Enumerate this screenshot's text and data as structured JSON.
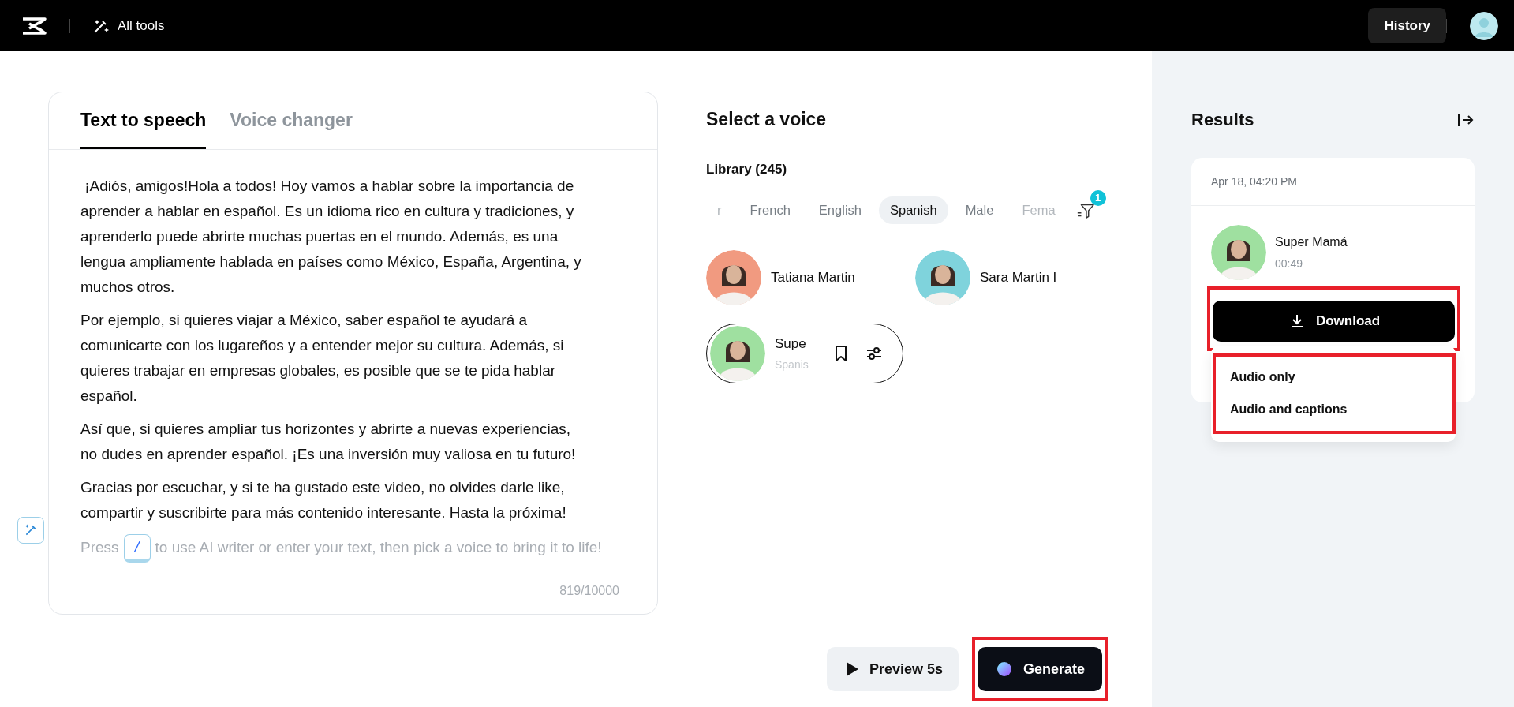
{
  "top_bar": {
    "all_tools": "All tools",
    "history": "History"
  },
  "editor": {
    "tabs": [
      {
        "label": "Text to speech",
        "selected": true
      },
      {
        "label": "Voice changer",
        "selected": false
      }
    ],
    "paragraphs": [
      " ¡Adiós, amigos!Hola a todos! Hoy vamos a hablar sobre la importancia de aprender a hablar en español. Es un idioma rico en cultura y tradiciones, y aprenderlo puede abrirte muchas puertas en el mundo. Además, es una lengua ampliamente hablada en países como México, España, Argentina, y muchos otros.",
      "Por ejemplo, si quieres viajar a México, saber español te ayudará a comunicarte con los lugareños y a entender mejor su cultura. Además, si quieres trabajar en empresas globales, es posible que se te pida hablar español.",
      "Así que, si quieres ampliar tus horizontes y abrirte a nuevas experiencias, no dudes en aprender español. ¡Es una inversión muy valiosa en tu futuro!",
      "Gracias por escuchar, y si te ha gustado este video, no olvides darle like, compartir y suscribirte para más contenido interesante. Hasta la próxima!"
    ],
    "hint": {
      "before": "Press",
      "key": "/",
      "after": "to use AI writer or enter your text, then pick a voice to bring it to life!"
    },
    "counter": "819/10000"
  },
  "voices": {
    "title": "Select a voice",
    "library": "Library (245)",
    "filters": [
      {
        "label": "r",
        "selected": false,
        "faded": true
      },
      {
        "label": "French",
        "selected": false,
        "faded": false
      },
      {
        "label": "English",
        "selected": false,
        "faded": false
      },
      {
        "label": "Spanish",
        "selected": true,
        "faded": false
      },
      {
        "label": "Male",
        "selected": false,
        "faded": false
      },
      {
        "label": "Fema",
        "selected": false,
        "faded": true
      }
    ],
    "filter_badge": "1",
    "items": [
      {
        "name": "Tatiana Martin",
        "color": "#f19a80",
        "selected": false
      },
      {
        "name": "Sara Martin I",
        "color": "#7fd3dc",
        "selected": false
      },
      {
        "name": "Supe",
        "subtitle": "Spanis",
        "color": "#9fe0a0",
        "selected": true
      }
    ]
  },
  "actions": {
    "preview": {
      "label": "Preview 5s",
      "highlighted": false
    },
    "generate": {
      "label": "Generate",
      "highlighted": true
    }
  },
  "results": {
    "title": "Results",
    "card": {
      "date": "Apr 18, 04:20 PM",
      "voice": "Super Mamá",
      "duration": "00:49",
      "color": "#9fe0a0",
      "download": {
        "label": "Download",
        "highlighted": true
      },
      "menu": {
        "highlighted": true,
        "items": [
          "Audio only",
          "Audio and captions"
        ]
      }
    }
  }
}
